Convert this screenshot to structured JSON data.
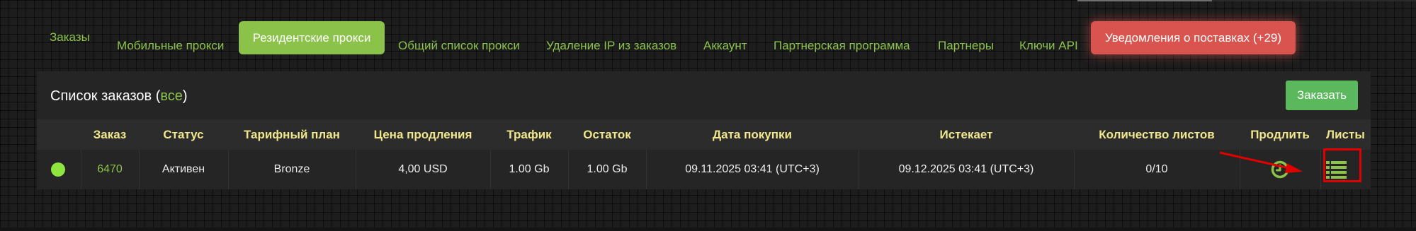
{
  "nav": {
    "items": [
      {
        "label": "Заказы"
      },
      {
        "label": "Мобильные прокси"
      },
      {
        "label": "Резидентские прокси"
      },
      {
        "label": "Общий список прокси"
      },
      {
        "label": "Удаление IP из заказов"
      },
      {
        "label": "Аккаунт"
      },
      {
        "label": "Партнерская программа"
      },
      {
        "label": "Партнеры"
      },
      {
        "label": "Ключи API"
      },
      {
        "label": "Уведомления о поставках (+29)"
      }
    ],
    "active_index": 2
  },
  "panel": {
    "title_prefix": "Список заказов (",
    "title_link": "все",
    "title_suffix": ")",
    "order_button": "Заказать"
  },
  "table": {
    "headers": [
      "",
      "Заказ",
      "Статус",
      "Тарифный план",
      "Цена продления",
      "Трафик",
      "Остаток",
      "Дата покупки",
      "Истекает",
      "Количество листов",
      "Продлить",
      "Листы"
    ],
    "rows": [
      {
        "status_indicator": "online-dot",
        "order": "6470",
        "status": "Активен",
        "plan": "Bronze",
        "renew_price": "4,00 USD",
        "traffic": "1.00 Gb",
        "remaining": "1.00 Gb",
        "purchase_date": "09.11.2025 03:41 (UTC+3)",
        "expires": "09.12.2025 03:41 (UTC+3)",
        "lists_count": "0/10",
        "renew_icon": "clock-icon",
        "lists_icon": "list-icon"
      }
    ]
  },
  "colors": {
    "accent": "#8bc34a",
    "header_text": "#f0e68c",
    "notify": "#d9534f",
    "order_button": "#5cb85c",
    "annotation": "#e00000"
  }
}
